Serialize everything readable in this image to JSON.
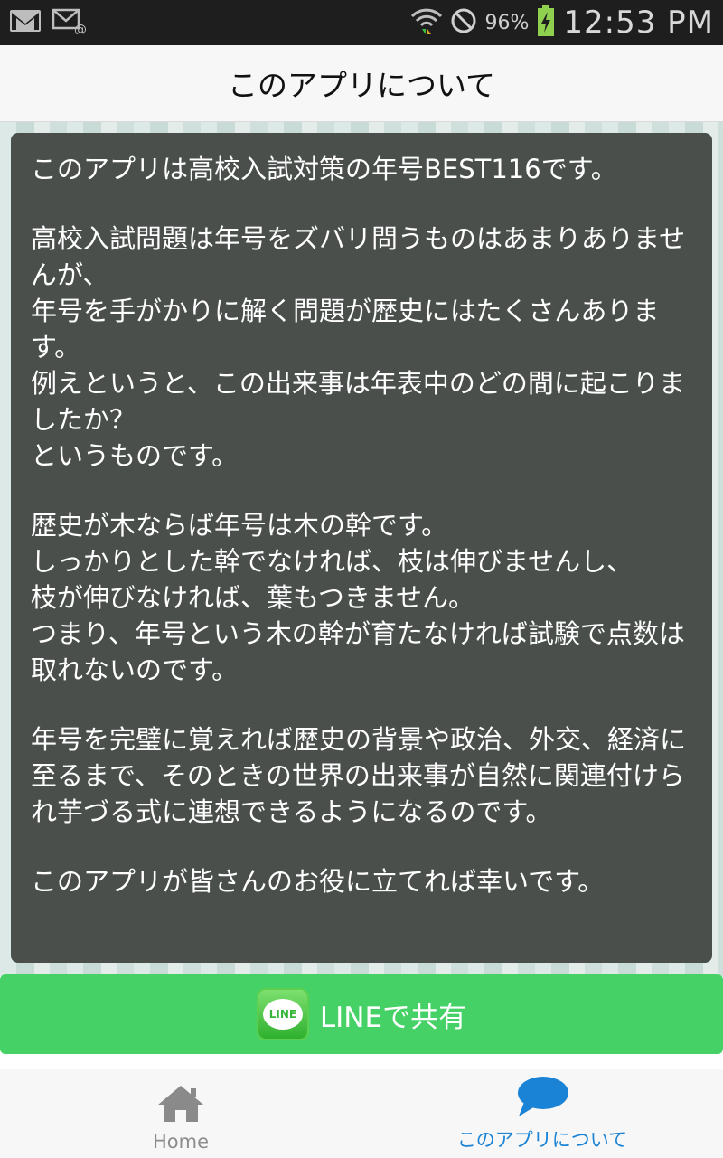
{
  "status_bar": {
    "battery_percent": "96%",
    "time": "12:53 PM",
    "icons": [
      "gmail-icon",
      "email-icon",
      "wifi-icon",
      "no-disturb-icon",
      "battery-charging-icon"
    ]
  },
  "header": {
    "title": "このアプリについて"
  },
  "content": {
    "paragraphs": [
      "このアプリは高校入試対策の年号BEST116です。",
      "高校入試問題は年号をズバリ問うものはあまりありませんが、\n年号を手がかりに解く問題が歴史にはたくさんあります。\n例えというと、この出来事は年表中のどの間に起こりましたか？\nというものです。",
      "歴史が木ならば年号は木の幹です。\nしっかりとした幹でなければ、枝は伸びませんし、\n枝が伸びなければ、葉もつきません。\nつまり、年号という木の幹が育たなければ試験で点数は取れないのです。",
      "年号を完璧に覚えれば歴史の背景や政治、外交、経済に至るまで、そのときの世界の出来事が自然に関連付けられ芋づる式に連想できるようになるのです。",
      "このアプリが皆さんのお役に立てれば幸いです。"
    ]
  },
  "share": {
    "logo_text": "LINE",
    "label": "LINEで共有"
  },
  "bottom_nav": {
    "items": [
      {
        "label": "Home",
        "icon": "home-icon",
        "active": false
      },
      {
        "label": "このアプリについて",
        "icon": "speech-bubble-icon",
        "active": true
      }
    ]
  },
  "colors": {
    "share_green": "#45d166",
    "panel": "#4a4f4c",
    "active_tab": "#1a83d6"
  }
}
